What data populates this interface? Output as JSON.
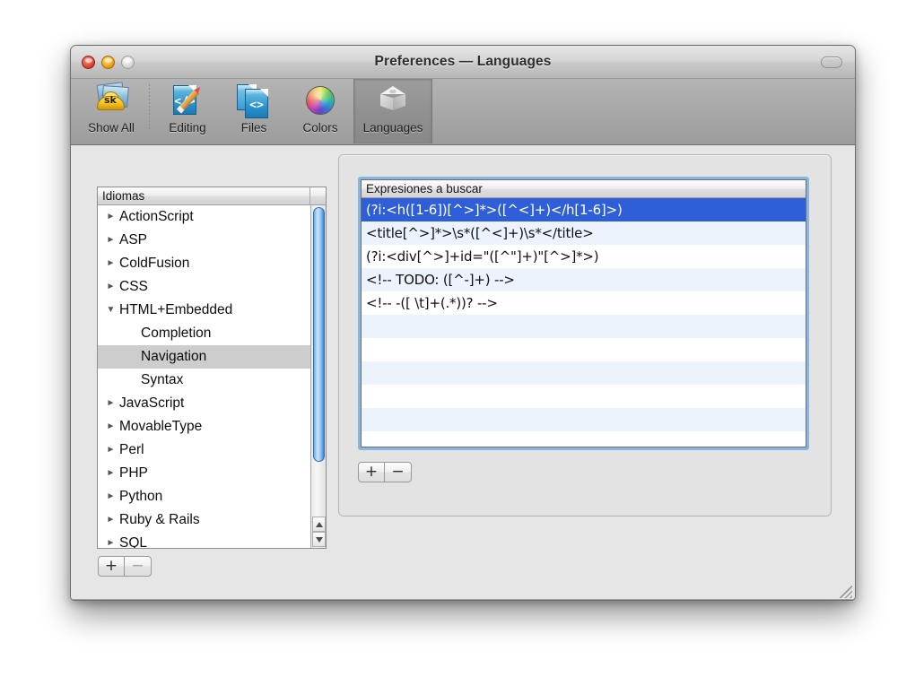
{
  "window": {
    "title": "Preferences — Languages",
    "controls": {
      "close": "close-button",
      "minimize": "minimize-button",
      "zoom": "zoom-button",
      "toolbar_toggle": "toolbar-toggle-button"
    }
  },
  "toolbar": {
    "items": [
      {
        "label": "Show All",
        "icon": "show-all-icon",
        "selected": false
      },
      {
        "label": "Editing",
        "icon": "editing-icon",
        "selected": false
      },
      {
        "label": "Files",
        "icon": "files-icon",
        "selected": false
      },
      {
        "label": "Colors",
        "icon": "colors-icon",
        "selected": false
      },
      {
        "label": "Languages",
        "icon": "languages-icon",
        "selected": true
      }
    ]
  },
  "sidebar": {
    "header": "Idiomas",
    "rows": [
      {
        "label": "ActionScript",
        "level": 0,
        "expanded": false,
        "selected": false
      },
      {
        "label": "ASP",
        "level": 0,
        "expanded": false,
        "selected": false
      },
      {
        "label": "ColdFusion",
        "level": 0,
        "expanded": false,
        "selected": false
      },
      {
        "label": "CSS",
        "level": 0,
        "expanded": false,
        "selected": false
      },
      {
        "label": "HTML+Embedded",
        "level": 0,
        "expanded": true,
        "selected": false
      },
      {
        "label": "Completion",
        "level": 1,
        "expanded": null,
        "selected": false
      },
      {
        "label": "Navigation",
        "level": 1,
        "expanded": null,
        "selected": true
      },
      {
        "label": "Syntax",
        "level": 1,
        "expanded": null,
        "selected": false
      },
      {
        "label": "JavaScript",
        "level": 0,
        "expanded": false,
        "selected": false
      },
      {
        "label": "MovableType",
        "level": 0,
        "expanded": false,
        "selected": false
      },
      {
        "label": "Perl",
        "level": 0,
        "expanded": false,
        "selected": false
      },
      {
        "label": "PHP",
        "level": 0,
        "expanded": false,
        "selected": false
      },
      {
        "label": "Python",
        "level": 0,
        "expanded": false,
        "selected": false
      },
      {
        "label": "Ruby & Rails",
        "level": 0,
        "expanded": false,
        "selected": false
      },
      {
        "label": "SQL",
        "level": 0,
        "expanded": false,
        "selected": false
      }
    ],
    "add_label": "+",
    "remove_label": "−",
    "remove_disabled": true
  },
  "table": {
    "header": "Expresiones a buscar",
    "rows": [
      {
        "value": "(?i:<h([1-6])[^>]*>([^<]+)</h[1-6]>)",
        "selected": true
      },
      {
        "value": "<title[^>]*>\\s*([^<]+)\\s*</title>",
        "selected": false
      },
      {
        "value": "(?i:<div[^>]+id=\"([^\"]+)\"[^>]*>)",
        "selected": false
      },
      {
        "value": "<!-- TODO: ([^-]+) -->",
        "selected": false
      },
      {
        "value": "<!-- -([ \\t]+(.*))? -->",
        "selected": false
      },
      {
        "value": "",
        "selected": false
      },
      {
        "value": "",
        "selected": false
      },
      {
        "value": "",
        "selected": false
      },
      {
        "value": "",
        "selected": false
      },
      {
        "value": "",
        "selected": false
      },
      {
        "value": "",
        "selected": false
      }
    ],
    "add_label": "+",
    "remove_label": "−"
  },
  "colors": {
    "selection_blue": "#2f5fd8",
    "stripe_blue": "#edf3fd",
    "inactive_selection": "#cdcdcd",
    "focus_ring": "#68a0d8",
    "scroller_blue": "#6aa9e8",
    "window_bg": "#e6e6e6",
    "toolbar_bg": "#a8a8a8"
  }
}
